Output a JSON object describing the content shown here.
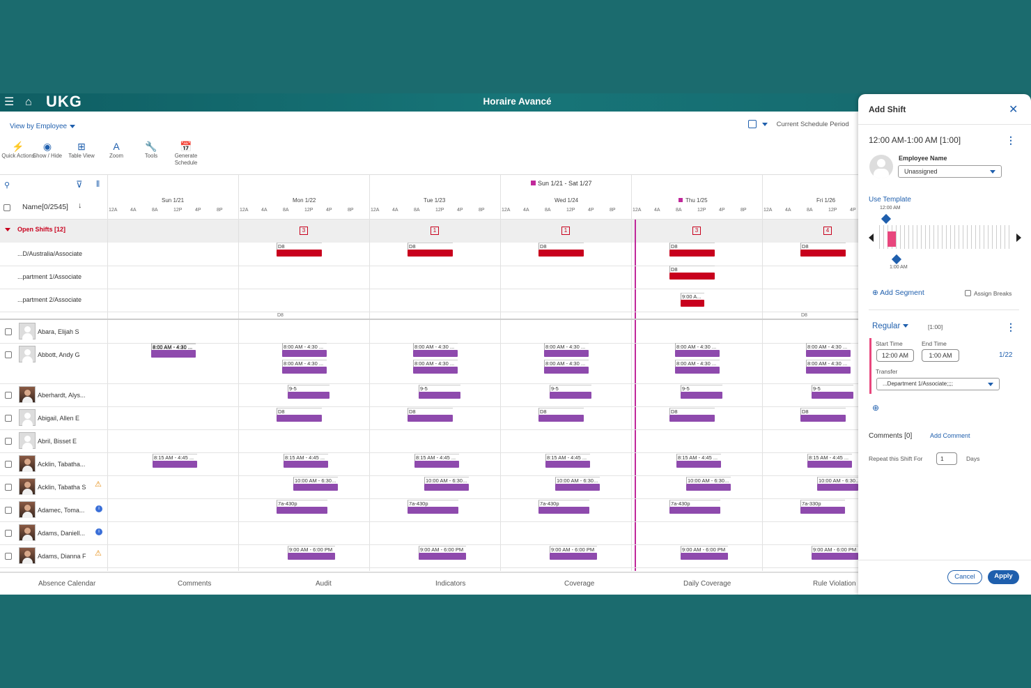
{
  "app": {
    "title": "Horaire Avancé",
    "logo": "UKG"
  },
  "toolbar": {
    "view_by": "View by Employee",
    "period_label": "Current Schedule Period",
    "tools": [
      {
        "label": "Quick Actions",
        "icon": "lightning-icon"
      },
      {
        "label": "Show / Hide",
        "icon": "eye-icon"
      },
      {
        "label": "Table View",
        "icon": "table-icon"
      },
      {
        "label": "Zoom",
        "icon": "zoom-icon"
      },
      {
        "label": "Tools",
        "icon": "wrench-icon"
      },
      {
        "label": "Generate Schedule",
        "icon": "calendar-generate-icon"
      }
    ]
  },
  "grid": {
    "range_label": "Sun 1/21 - Sat 1/27",
    "name_header": "Name[0/2545]",
    "days": [
      "Sun 1/21",
      "Mon 1/22",
      "Tue 1/23",
      "Wed 1/24",
      "Thu 1/25",
      "Fri 1/26"
    ],
    "hours": [
      "12A",
      "4A",
      "8A",
      "12P",
      "4P",
      "8P"
    ],
    "open_shifts_label": "Open Shifts [12]",
    "open_counts": [
      "",
      "3",
      "1",
      "1",
      "3",
      "4"
    ],
    "open_rows": [
      "...D/Australia/Associate",
      "...partment 1/Associate",
      "...partment 2/Associate"
    ],
    "d8": "D8",
    "nine_am": "9:00 A...",
    "employees": [
      "Abara, Elijah S",
      "Abbott, Andy G",
      "Aberhardt, Alys...",
      "Abigail, Allen E",
      "Abril, Bisset E",
      "Acklin, Tabatha...",
      "Acklin, Tabatha S",
      "Adamec, Toma...",
      "Adams, Daniell...",
      "Adams, Dianna F"
    ],
    "shift_labels": {
      "s800": "8:00 AM - 4:30 ...",
      "s95": "9-5",
      "s815": "8:15 AM - 4:45 ...",
      "s1000": "10:00 AM - 6:30...",
      "s7a": "7a-430p",
      "s7a330": "7a-330p",
      "s900": "9:00 AM - 6:00 PM"
    }
  },
  "tabs": [
    "Absence Calendar",
    "Comments",
    "Audit",
    "Indicators",
    "Coverage",
    "Daily Coverage",
    "Rule Violation"
  ],
  "panel": {
    "title": "Add Shift",
    "time_range": "12:00 AM-1:00 AM [1:00]",
    "employee_name_label": "Employee Name",
    "employee_value": "Unassigned",
    "use_template": "Use Template",
    "slider_start": "12:00 AM",
    "slider_end": "1:00 AM",
    "add_segment": "Add Segment",
    "assign_breaks": "Assign Breaks",
    "segment_type": "Regular",
    "segment_duration": "[1:00]",
    "start_label": "Start Time",
    "end_label": "End Time",
    "start_value": "12:00 AM",
    "end_value": "1:00 AM",
    "date": "1/22",
    "transfer_label": "Transfer",
    "transfer_value": "...Department 1/Associate;;;;",
    "comments_label": "Comments [0]",
    "add_comment": "Add Comment",
    "repeat_label": "Repeat this Shift For",
    "repeat_value": "1",
    "days_label": "Days",
    "cancel": "Cancel",
    "apply": "Apply"
  },
  "colors": {
    "accent": "#1f5fad",
    "open_shift": "#c8001d",
    "shift": "#8e4aad",
    "today_line": "#c0289a",
    "header": "#177578"
  }
}
